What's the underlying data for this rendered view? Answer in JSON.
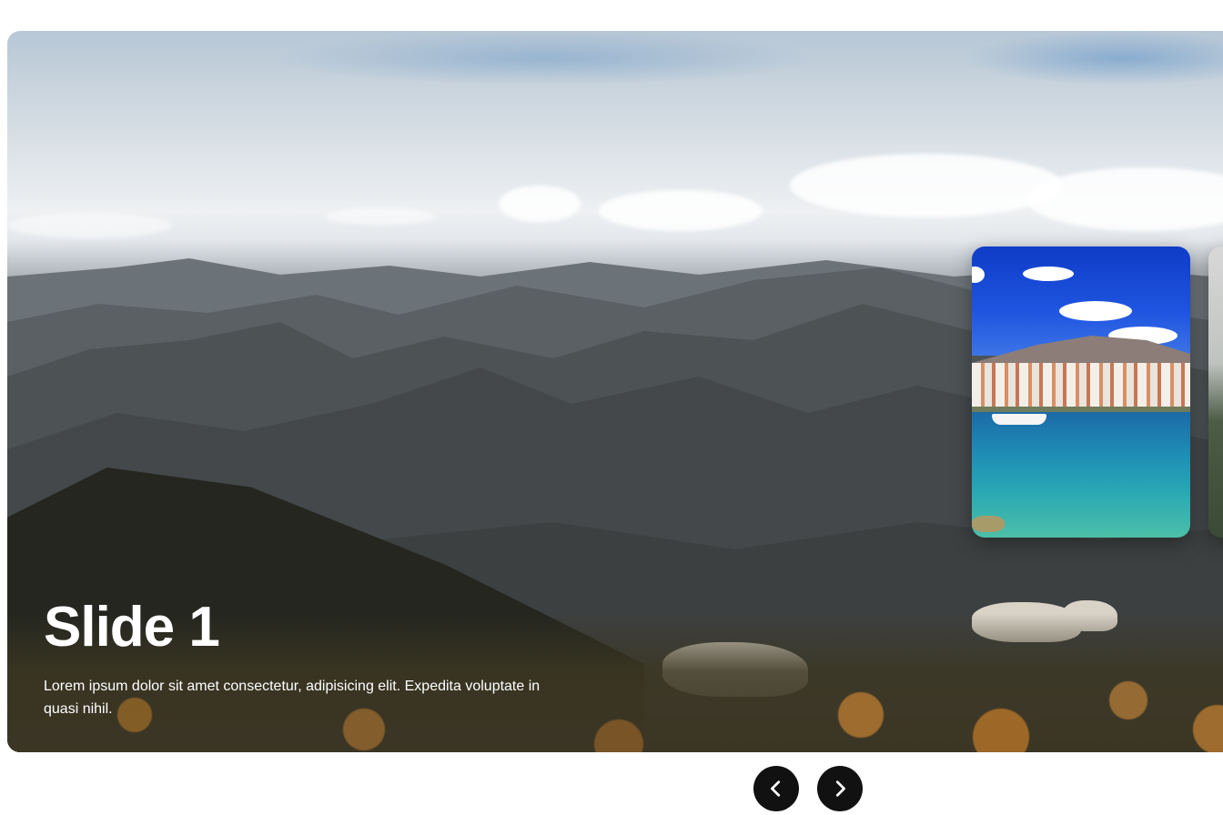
{
  "slides": [
    {
      "title": "Slide 1",
      "description": "Lorem ipsum dolor sit amet consectetur, adipisicing elit. Expedita voluptate in quasi nihil."
    }
  ],
  "thumbnails": [
    {
      "name": "coastal-town-thumbnail"
    },
    {
      "name": "partial-thumbnail"
    }
  ],
  "controls": {
    "prev_icon": "chevron-left-icon",
    "next_icon": "chevron-right-icon"
  },
  "colors": {
    "button_bg": "#111111",
    "button_fg": "#ffffff",
    "caption_text": "#ffffff",
    "page_bg": "#ffffff"
  }
}
